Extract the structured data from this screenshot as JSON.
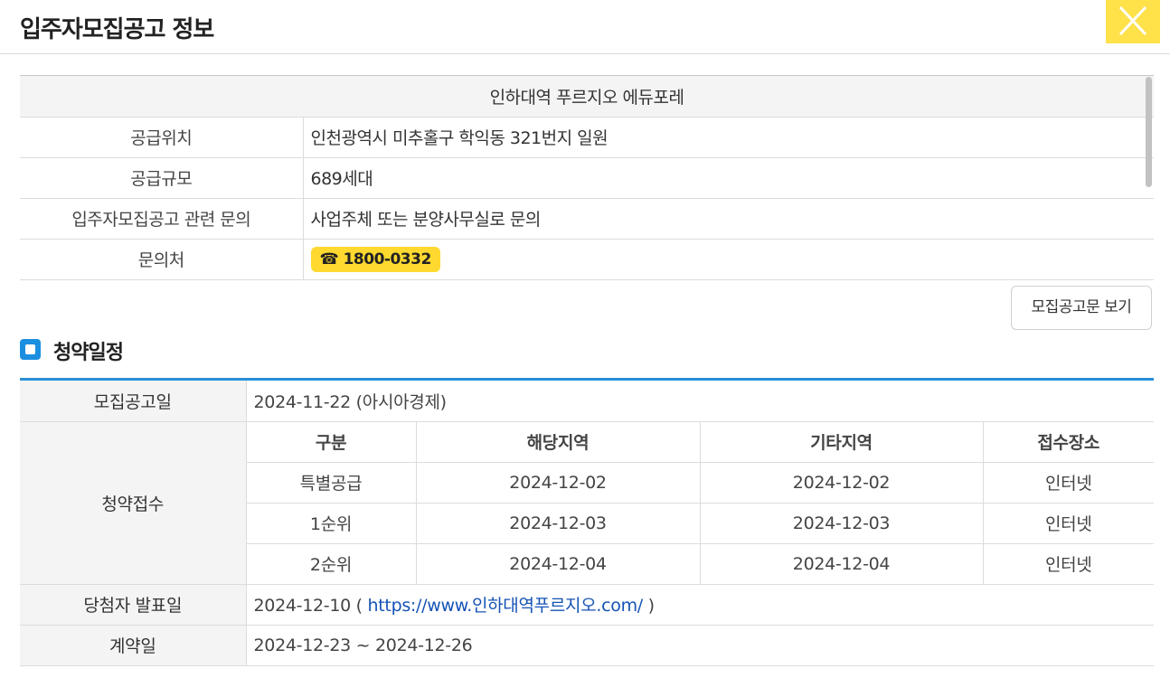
{
  "header": {
    "title": "입주자모집공고 정보",
    "close_icon": "close-icon"
  },
  "info": {
    "complex_name": "인하대역 푸르지오 에듀포레",
    "rows": [
      {
        "label": "공급위치",
        "value": "인천광역시 미추홀구 학익동 321번지 일원"
      },
      {
        "label": "공급규모",
        "value": "689세대"
      },
      {
        "label": "입주자모집공고 관련 문의",
        "value": "사업주체 또는 분양사무실로 문의"
      }
    ],
    "contact_label": "문의처",
    "contact_phone": "☎ 1800-0332"
  },
  "notice_button": "모집공고문 보기",
  "schedule": {
    "title": "청약일정",
    "announce_label": "모집공고일",
    "announce_value": "2024-11-22 (아시아경제)",
    "apply_label": "청약접수",
    "columns": [
      "구분",
      "해당지역",
      "기타지역",
      "접수장소"
    ],
    "rows": [
      {
        "type": "특별공급",
        "local": "2024-12-02",
        "other": "2024-12-02",
        "place": "인터넷"
      },
      {
        "type": "1순위",
        "local": "2024-12-03",
        "other": "2024-12-03",
        "place": "인터넷"
      },
      {
        "type": "2순위",
        "local": "2024-12-04",
        "other": "2024-12-04",
        "place": "인터넷"
      }
    ],
    "winner_label": "당첨자 발표일",
    "winner_date": "2024-12-10 (",
    "winner_link": "https://www.인하대역푸르지오.com/",
    "winner_close": ")",
    "contract_label": "계약일",
    "contract_value": "2024-12-23 ~ 2024-12-26"
  },
  "colors": {
    "accent_yellow": "#ffe14a",
    "phone_badge": "#ffd92f",
    "section_blue": "#2a8fd8",
    "link_blue": "#1553b5"
  }
}
